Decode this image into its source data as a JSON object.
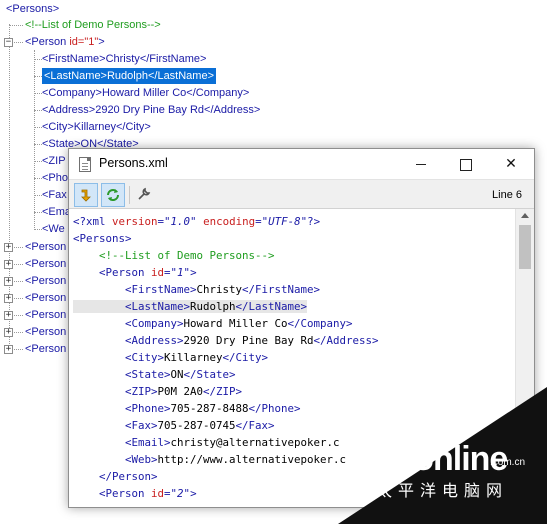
{
  "tree": {
    "root_label": "<Persons>",
    "comment": "<!--List of Demo Persons-->",
    "person_open_prefix": "<Person ",
    "person_attr": "id=\"1\"",
    "person_open_suffix": ">",
    "children": [
      {
        "open": "<FirstName>",
        "text": "Christy",
        "close": "</FirstName>"
      },
      {
        "open": "<LastName>",
        "text": "Rudolph",
        "close": "</LastName>"
      },
      {
        "open": "<Company>",
        "text": "Howard Miller Co",
        "close": "</Company>"
      },
      {
        "open": "<Address>",
        "text": "2920 Dry Pine Bay Rd",
        "close": "</Address>"
      },
      {
        "open": "<City>",
        "text": "Killarney",
        "close": "</City>"
      },
      {
        "open": "<State>",
        "text": "ON",
        "close": "</State>"
      },
      {
        "open": "<ZIP",
        "text": "",
        "close": ""
      },
      {
        "open": "<Pho",
        "text": "",
        "close": ""
      },
      {
        "open": "<Fax",
        "text": "",
        "close": ""
      },
      {
        "open": "<Ema",
        "text": "",
        "close": ""
      },
      {
        "open": "<We",
        "text": "",
        "close": ""
      }
    ],
    "collapsed_persons": [
      "<Person",
      "<Person",
      "<Person",
      "<Person",
      "<Person",
      "<Person",
      "<Person"
    ]
  },
  "window": {
    "title": "Persons.xml",
    "line_info": "Line 6",
    "close_glyph": "✕"
  },
  "icons": {
    "file": "document-icon",
    "toolbar": [
      "format-arrow-icon",
      "refresh-icon",
      "wrench-icon"
    ]
  },
  "code_lines": [
    [
      {
        "c": "ctag",
        "t": "<?xml "
      },
      {
        "c": "cattr",
        "t": "version"
      },
      {
        "c": "ctag",
        "t": "="
      },
      {
        "c": "cval",
        "t": "\"1.0\""
      },
      {
        "c": "ctag",
        "t": " "
      },
      {
        "c": "cattr",
        "t": "encoding"
      },
      {
        "c": "ctag",
        "t": "="
      },
      {
        "c": "cval",
        "t": "\"UTF-8\""
      },
      {
        "c": "ctag",
        "t": "?>"
      }
    ],
    [
      {
        "c": "ctag",
        "t": "<Persons>"
      }
    ],
    [
      {
        "c": "ccom",
        "t": "    <!--List of Demo Persons-->"
      }
    ],
    [
      {
        "c": "ctag",
        "t": "    <Person "
      },
      {
        "c": "cattr",
        "t": "id"
      },
      {
        "c": "ctag",
        "t": "="
      },
      {
        "c": "cval",
        "t": "\"1\""
      },
      {
        "c": "ctag",
        "t": ">"
      }
    ],
    [
      {
        "c": "ctag",
        "t": "        <FirstName>"
      },
      {
        "c": "ctext",
        "t": "Christy"
      },
      {
        "c": "ctag",
        "t": "</FirstName>"
      }
    ],
    [
      {
        "c": "ctag",
        "t": "        <LastName>"
      },
      {
        "c": "ctext",
        "t": "Rudolph"
      },
      {
        "c": "ctag",
        "t": "</LastName>"
      }
    ],
    [
      {
        "c": "ctag",
        "t": "        <Company>"
      },
      {
        "c": "ctext",
        "t": "Howard Miller Co"
      },
      {
        "c": "ctag",
        "t": "</Company>"
      }
    ],
    [
      {
        "c": "ctag",
        "t": "        <Address>"
      },
      {
        "c": "ctext",
        "t": "2920 Dry Pine Bay Rd"
      },
      {
        "c": "ctag",
        "t": "</Address>"
      }
    ],
    [
      {
        "c": "ctag",
        "t": "        <City>"
      },
      {
        "c": "ctext",
        "t": "Killarney"
      },
      {
        "c": "ctag",
        "t": "</City>"
      }
    ],
    [
      {
        "c": "ctag",
        "t": "        <State>"
      },
      {
        "c": "ctext",
        "t": "ON"
      },
      {
        "c": "ctag",
        "t": "</State>"
      }
    ],
    [
      {
        "c": "ctag",
        "t": "        <ZIP>"
      },
      {
        "c": "ctext",
        "t": "P0M 2A0"
      },
      {
        "c": "ctag",
        "t": "</ZIP>"
      }
    ],
    [
      {
        "c": "ctag",
        "t": "        <Phone>"
      },
      {
        "c": "ctext",
        "t": "705-287-8488"
      },
      {
        "c": "ctag",
        "t": "</Phone>"
      }
    ],
    [
      {
        "c": "ctag",
        "t": "        <Fax>"
      },
      {
        "c": "ctext",
        "t": "705-287-0745"
      },
      {
        "c": "ctag",
        "t": "</Fax>"
      }
    ],
    [
      {
        "c": "ctag",
        "t": "        <Email>"
      },
      {
        "c": "ctext",
        "t": "christy@alternativepoker.c"
      }
    ],
    [
      {
        "c": "ctag",
        "t": "        <Web>"
      },
      {
        "c": "ctext",
        "t": "http://www.alternativepoker.c"
      }
    ],
    [
      {
        "c": "ctag",
        "t": "    </Person>"
      }
    ],
    [
      {
        "c": "ctag",
        "t": "    <Person "
      },
      {
        "c": "cattr",
        "t": "id"
      },
      {
        "c": "ctag",
        "t": "="
      },
      {
        "c": "cval",
        "t": "\"2\""
      },
      {
        "c": "ctag",
        "t": ">"
      }
    ]
  ],
  "highlight_line": 5,
  "watermark": {
    "brand": "PConline",
    "domain_suffix": ".com.cn",
    "tagline": "太平洋电脑网"
  }
}
